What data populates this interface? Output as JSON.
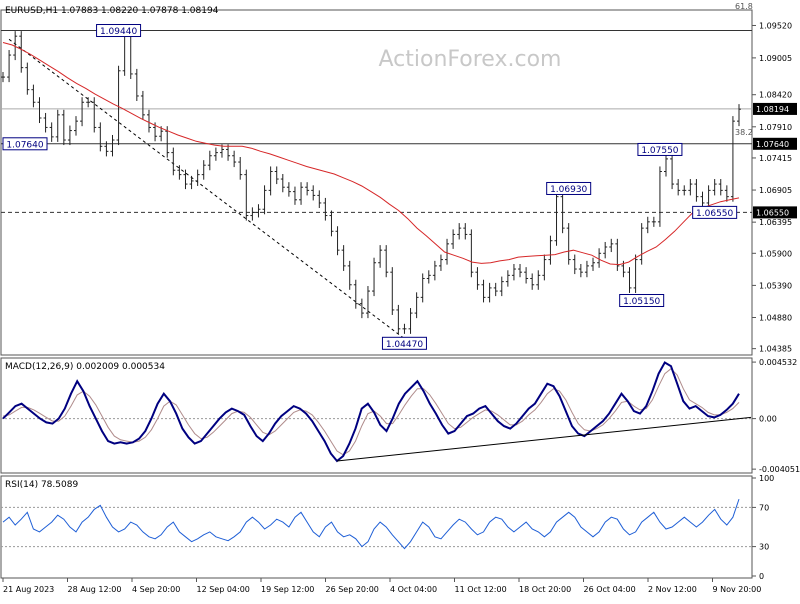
{
  "header": {
    "symbol_line": "EURUSD,H1  1.07883 1.08220 1.07878 1.08194",
    "watermark": "ActionForex.com"
  },
  "colors": {
    "price": "#222222",
    "ma": "#d62728",
    "macd": "#000080",
    "signal": "#b08c8c",
    "rsi": "#1f5fd6",
    "label_border": "#000080",
    "label_text": "#000080"
  },
  "chart_data": [
    {
      "type": "line",
      "name": "price",
      "title": "EURUSD,H1  1.07883 1.08220 1.07878 1.08194",
      "ylim": [
        1.043,
        1.0975
      ],
      "yticks": [
        "1.09520",
        "1.09005",
        "1.08420",
        "1.07910",
        "1.07415",
        "1.06905",
        "1.06395",
        "1.05900",
        "1.05390",
        "1.04880",
        "1.04385"
      ],
      "x_labels": [
        "21 Aug 2023",
        "28 Aug 12:00",
        "4 Sep 20:00",
        "12 Sep 04:00",
        "19 Sep 12:00",
        "26 Sep 20:00",
        "4 Oct 04:00",
        "11 Oct 12:00",
        "18 Oct 20:00",
        "26 Oct 04:00",
        "2 Nov 12:00",
        "9 Nov 20:00"
      ],
      "close": [
        1.087,
        1.0905,
        1.0935,
        1.0885,
        1.085,
        1.083,
        1.0805,
        1.079,
        1.0775,
        1.081,
        1.077,
        1.0785,
        1.08,
        1.083,
        1.083,
        1.079,
        1.076,
        1.0752,
        1.077,
        1.088,
        1.0935,
        1.0875,
        1.084,
        1.081,
        1.079,
        1.0776,
        1.0784,
        1.075,
        1.0722,
        1.0715,
        1.07,
        1.0705,
        1.0715,
        1.073,
        1.0745,
        1.075,
        1.0755,
        1.0745,
        1.0735,
        1.0715,
        1.065,
        1.0655,
        1.066,
        1.069,
        1.072,
        1.0708,
        1.0695,
        1.0688,
        1.0675,
        1.0695,
        1.069,
        1.0682,
        1.067,
        1.065,
        1.0625,
        1.0595,
        1.057,
        1.054,
        1.051,
        1.0495,
        1.053,
        1.0575,
        1.0595,
        1.056,
        1.05,
        1.047,
        1.047,
        1.0495,
        1.052,
        1.055,
        1.0555,
        1.057,
        1.058,
        1.0605,
        1.062,
        1.063,
        1.062,
        1.056,
        1.054,
        1.052,
        1.0535,
        1.053,
        1.0545,
        1.0555,
        1.0565,
        1.056,
        1.055,
        1.054,
        1.0555,
        1.058,
        1.061,
        1.068,
        1.063,
        1.058,
        1.0565,
        1.056,
        1.057,
        1.0575,
        1.059,
        1.06,
        1.0605,
        1.057,
        1.056,
        1.0535,
        1.058,
        1.063,
        1.064,
        1.064,
        1.072,
        1.074,
        1.07,
        1.069,
        1.069,
        1.07,
        1.068,
        1.067,
        1.069,
        1.07,
        1.069,
        1.068,
        1.08,
        1.0819
      ],
      "ma": [
        1.0925,
        1.0921,
        1.0914,
        1.0906,
        1.0897,
        1.0888,
        1.0879,
        1.0869,
        1.086,
        1.0852,
        1.0843,
        1.0835,
        1.0827,
        1.082,
        1.0812,
        1.0804,
        1.0797,
        1.079,
        1.0784,
        1.0778,
        1.0773,
        1.0768,
        1.0765,
        1.0762,
        1.076,
        1.076,
        1.076,
        1.0757,
        1.0752,
        1.0748,
        1.0743,
        1.0738,
        1.0733,
        1.0728,
        1.0724,
        1.072,
        1.0716,
        1.071,
        1.0704,
        1.0697,
        1.0688,
        1.0679,
        1.0668,
        1.0658,
        1.0645,
        1.063,
        1.0618,
        1.0605,
        1.0592,
        1.0587,
        1.0582,
        1.0576,
        1.0574,
        1.0575,
        1.0578,
        1.058,
        1.0584,
        1.0585,
        1.0586,
        1.0587,
        1.0588,
        1.0592,
        1.0595,
        1.0591,
        1.0587,
        1.0579,
        1.0573,
        1.0572,
        1.0576,
        1.0585,
        1.0593,
        1.06,
        1.0612,
        1.0625,
        1.064,
        1.0655,
        1.0662,
        1.0667,
        1.0672,
        1.0675,
        1.0678
      ],
      "levels": [
        {
          "value": 1.0944,
          "style": "solid",
          "label": "1.09440"
        },
        {
          "value": 1.0764,
          "style": "solid",
          "label": "1.07640"
        },
        {
          "value": 1.0655,
          "style": "dashed",
          "label": "1.06550"
        },
        {
          "value": 1.08194,
          "style": "solid",
          "label": "1.08194"
        }
      ],
      "fib_labels": [
        "61.8",
        "38.2"
      ],
      "annotations": [
        {
          "label": "1.09440",
          "x_index": 19,
          "y": 1.0944
        },
        {
          "label": "1.07640",
          "x_index": 0,
          "y": 1.0764
        },
        {
          "label": "1.04470",
          "x_index": 66,
          "y": 1.0447
        },
        {
          "label": "1.06930",
          "x_index": 93,
          "y": 1.0693
        },
        {
          "label": "1.05150",
          "x_index": 105,
          "y": 1.0515
        },
        {
          "label": "1.07550",
          "x_index": 108,
          "y": 1.0755
        },
        {
          "label": "1.06550",
          "x_index": 117,
          "y": 1.0655
        }
      ],
      "trendline": {
        "from": [
          1,
          1.093
        ],
        "to": [
          67,
          1.0447
        ]
      }
    },
    {
      "type": "line",
      "name": "macd",
      "title": "MACD(12,26,9) 0.002009 0.000534",
      "ylim": [
        -0.0042,
        0.0047
      ],
      "yticks": [
        "0.004532",
        "0.00",
        "-0.004051"
      ],
      "macd": [
        0.0,
        0.0005,
        0.001,
        0.0012,
        0.0008,
        0.0004,
        0.0,
        -0.0003,
        -0.0004,
        0.0,
        0.0008,
        0.002,
        0.003,
        0.0022,
        0.001,
        0.0,
        -0.001,
        -0.0018,
        -0.002,
        -0.0019,
        -0.002,
        -0.0019,
        -0.0016,
        -0.001,
        0.0,
        0.0012,
        0.002,
        0.0014,
        0.0004,
        -0.0008,
        -0.0015,
        -0.002,
        -0.0018,
        -0.0012,
        -0.0006,
        0.0,
        0.0005,
        0.0008,
        0.0006,
        0.0003,
        -0.0006,
        -0.0014,
        -0.0018,
        -0.0012,
        -0.0004,
        0.0002,
        0.0006,
        0.001,
        0.0008,
        0.0004,
        -0.0002,
        -0.001,
        -0.0018,
        -0.0028,
        -0.0034,
        -0.003,
        -0.002,
        -0.0008,
        0.0008,
        0.0012,
        0.0005,
        -0.0005,
        -0.001,
        0.0,
        0.0012,
        0.002,
        0.0025,
        0.003,
        0.0022,
        0.0012,
        0.0004,
        -0.0005,
        -0.0012,
        -0.001,
        -0.0004,
        0.0002,
        0.0004,
        0.0008,
        0.001,
        0.0004,
        -0.0002,
        -0.0006,
        -0.0008,
        -0.0004,
        0.0002,
        0.0008,
        0.0012,
        0.002,
        0.0028,
        0.0026,
        0.0018,
        0.0006,
        -0.0006,
        -0.0012,
        -0.0014,
        -0.001,
        -0.0006,
        -0.0002,
        0.0004,
        0.0012,
        0.002,
        0.0014,
        0.0006,
        0.0004,
        0.001,
        0.0022,
        0.0036,
        0.0045,
        0.0042,
        0.0028,
        0.0014,
        0.0008,
        0.001,
        0.0006,
        0.0002,
        0.0001,
        0.0003,
        0.0007,
        0.0012,
        0.002
      ],
      "signal": [
        0.0002,
        0.0003,
        0.0006,
        0.0009,
        0.0009,
        0.0007,
        0.0004,
        0.0001,
        -0.0002,
        -0.0002,
        0.0002,
        0.001,
        0.0019,
        0.0022,
        0.0018,
        0.0011,
        0.0002,
        -0.0007,
        -0.0014,
        -0.0017,
        -0.0018,
        -0.0019,
        -0.0018,
        -0.0015,
        -0.0009,
        0.0,
        0.001,
        0.0014,
        0.0011,
        0.0003,
        -0.0005,
        -0.0012,
        -0.0016,
        -0.0015,
        -0.0011,
        -0.0006,
        -0.0001,
        0.0004,
        0.0006,
        0.0005,
        0.0001,
        -0.0005,
        -0.0011,
        -0.0013,
        -0.001,
        -0.0005,
        0.0,
        0.0005,
        0.0007,
        0.0006,
        0.0003,
        -0.0003,
        -0.001,
        -0.0018,
        -0.0026,
        -0.0029,
        -0.0026,
        -0.0018,
        -0.0006,
        0.0004,
        0.0006,
        0.0002,
        -0.0004,
        -0.0004,
        0.0003,
        0.0011,
        0.0018,
        0.0024,
        0.0024,
        0.0019,
        0.0012,
        0.0004,
        -0.0004,
        -0.0008,
        -0.0007,
        -0.0003,
        0.0001,
        0.0004,
        0.0007,
        0.0006,
        0.0003,
        -0.0001,
        -0.0005,
        -0.0005,
        -0.0002,
        0.0003,
        0.0007,
        0.0013,
        0.002,
        0.0024,
        0.0022,
        0.0015,
        0.0005,
        -0.0004,
        -0.0009,
        -0.001,
        -0.0008,
        -0.0005,
        0.0,
        0.0006,
        0.0013,
        0.0014,
        0.001,
        0.0007,
        0.0008,
        0.0015,
        0.0026,
        0.0036,
        0.004,
        0.0035,
        0.0024,
        0.0015,
        0.0012,
        0.0009,
        0.0005,
        0.0003,
        0.0003,
        0.0005,
        0.0008,
        0.0013
      ]
    },
    {
      "type": "line",
      "name": "rsi",
      "title": "RSI(14) 78.5089",
      "ylim": [
        0,
        100
      ],
      "yticks": [
        "100",
        "70",
        "30",
        "0"
      ],
      "levels": [
        70,
        30
      ],
      "values": [
        55,
        60,
        52,
        58,
        65,
        48,
        45,
        50,
        55,
        62,
        58,
        50,
        45,
        55,
        60,
        68,
        72,
        60,
        50,
        45,
        48,
        55,
        52,
        45,
        40,
        38,
        42,
        50,
        55,
        45,
        40,
        35,
        38,
        42,
        45,
        40,
        38,
        36,
        40,
        45,
        55,
        60,
        55,
        48,
        52,
        58,
        55,
        50,
        60,
        65,
        55,
        45,
        40,
        50,
        55,
        45,
        40,
        42,
        38,
        30,
        35,
        48,
        55,
        50,
        42,
        35,
        28,
        35,
        45,
        55,
        50,
        40,
        38,
        45,
        52,
        58,
        55,
        48,
        42,
        45,
        55,
        60,
        58,
        50,
        45,
        50,
        55,
        48,
        45,
        40,
        45,
        55,
        60,
        65,
        60,
        50,
        45,
        40,
        45,
        55,
        60,
        58,
        48,
        42,
        45,
        55,
        60,
        65,
        55,
        48,
        50,
        55,
        60,
        55,
        50,
        55,
        62,
        68,
        58,
        52,
        60,
        78.5
      ]
    }
  ]
}
